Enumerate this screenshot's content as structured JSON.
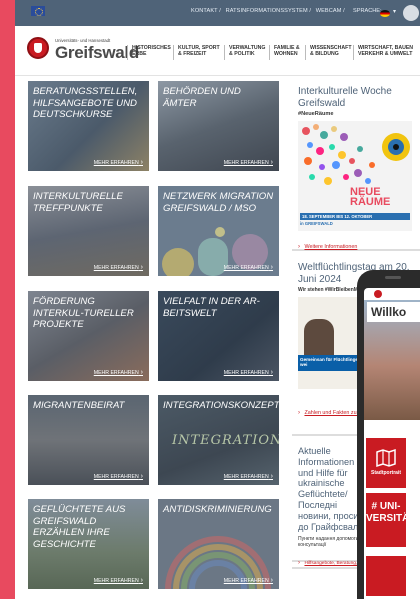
{
  "topbar": {
    "links": [
      "KONTAKT /",
      "RATSINFORMATIONSSYSTEM /",
      "WEBCAM /"
    ],
    "language_label": "SPRACHE:"
  },
  "header": {
    "logo_small": "Universitäts- und Hansestadt",
    "logo_text": "Greifswald",
    "nav": [
      {
        "line1": "HISTORISCHES",
        "line2": "ERBE"
      },
      {
        "line1": "KULTUR, SPORT",
        "line2": "& FREIZEIT"
      },
      {
        "line1": "VERWALTUNG",
        "line2": "& POLITIK"
      },
      {
        "line1": "FAMILIE &",
        "line2": "WOHNEN"
      },
      {
        "line1": "WISSENSCHAFT",
        "line2": "& BILDUNG"
      },
      {
        "line1": "WIRTSCHAFT, BAUEN",
        "line2": "VERKEHR & UMWELT"
      }
    ]
  },
  "tiles": [
    {
      "title": "BERATUNGSSTELLEN, HILFSANGEBOTE UND DEUTSCHKURSE",
      "more": "MEHR ERFAHREN"
    },
    {
      "title": "BEHÖRDEN UND ÄMTER",
      "more": "MEHR ERFAHREN"
    },
    {
      "title": "INTERKULTURELLE TREFFPUNKTE",
      "more": "MEHR ERFAHREN"
    },
    {
      "title": "NETZWERK MIGRATION GREIFSWALD / MSO",
      "more": "MEHR ERFAHREN"
    },
    {
      "title": "FÖRDERUNG INTERKUL-TURELLER PROJEKTE",
      "more": "MEHR ERFAHREN"
    },
    {
      "title": "VIELFALT IN DER AR-BEITSWELT",
      "more": "MEHR ERFAHREN"
    },
    {
      "title": "MIGRANTENBEIRAT",
      "more": "MEHR ERFAHREN"
    },
    {
      "title": "INTEGRATIONSKONZEPT",
      "more": "MEHR ERFAHREN"
    },
    {
      "title": "GEFLÜCHTETE AUS GREIFSWALD ERZÄHLEN IHRE GESCHICHTE",
      "more": "MEHR ERFAHREN"
    },
    {
      "title": "ANTIDISKRIMINIERUNG",
      "more": "MEHR ERFAHREN"
    }
  ],
  "side1": {
    "title": "Interkulturelle Woche Greifswald",
    "tag": "#NeueRäume",
    "poster_title": "NEUE RÄUME",
    "poster_dates": "18. SEPTEMBER BIS 12. OKTOBER",
    "poster_place": "in GREIFSWALD",
    "link": "Weitere Informationen"
  },
  "side2": {
    "title": "Weltflüchtlingstag am 20. Juni 2024",
    "subtitle": "Wir stehen #WirBleibenMenschlich",
    "banner": "Gemeinsan für Flüchtlinge wei",
    "link": "Zahlen und Fakten zu der Flucht »"
  },
  "side3": {
    "title": "Aktuelle Informationen und Hilfe für ukrainische Geflüchtete/Последні новини, просимо до Грайфсвальд",
    "text": "Пункти надання допомоги консультації",
    "link": "Hilfsangebote, Beratung, Ansprechpartner*innen"
  },
  "phone": {
    "welcome": "Willko",
    "tile1_label": "Stadtportrait",
    "tile2_label": "# UNI-VERSITÄT"
  }
}
